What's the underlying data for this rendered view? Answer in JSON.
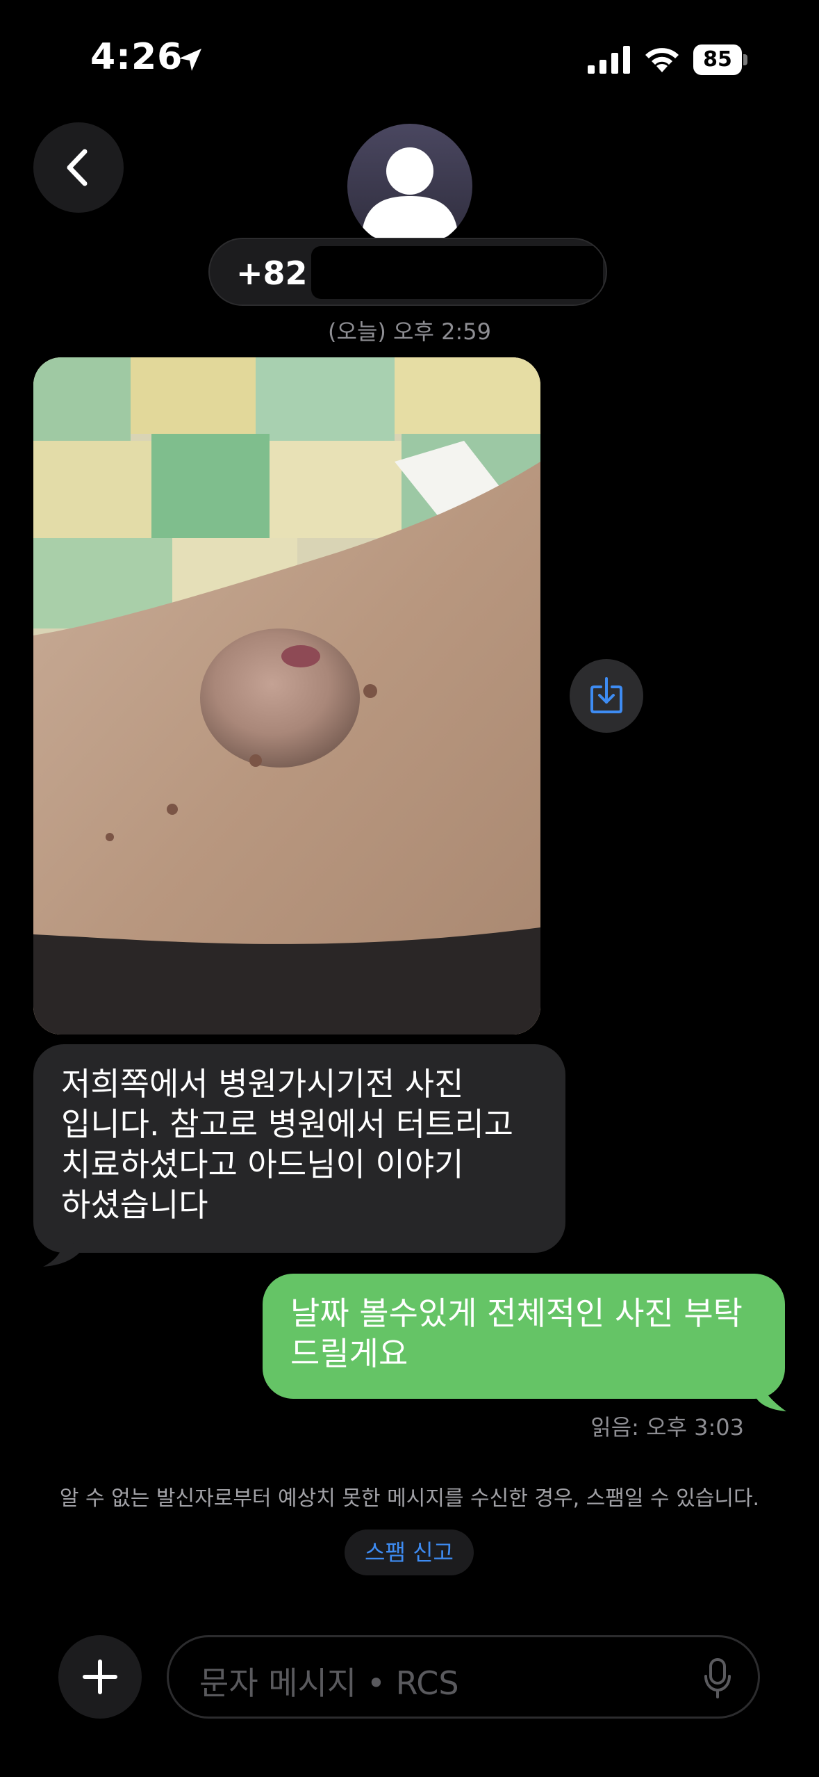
{
  "status_bar": {
    "time": "4:26",
    "battery": "85",
    "icons": [
      "location-arrow-icon",
      "cellular-signal-icon",
      "wifi-icon",
      "battery-icon"
    ]
  },
  "header": {
    "contact_number": "+82 1",
    "subtitle_hidden": "",
    "timestamp": "(오늘) 오후 2:59"
  },
  "messages": {
    "incoming_text_lines": [
      "저희쪽에서 병원가시기전 사진",
      "입니다. 참고로 병원에서 터트리고",
      "치료하셨다고 아드님이 이야기",
      "하셨습니다"
    ],
    "outgoing_text_lines": [
      "날짜 볼수있게 전체적인 사진 부탁",
      "드릴게요"
    ],
    "read_receipt": "읽음: 오후 3:03"
  },
  "spam": {
    "notice": "알 수 없는 발신자로부터 예상치 못한 메시지를 수신한 경우, 스팸일 수 있습니다.",
    "report_label": "스팸 신고"
  },
  "composer": {
    "placeholder": "문자 메시지 • RCS"
  },
  "colors": {
    "background": "#000000",
    "incoming_bubble": "#262628",
    "outgoing_bubble": "#65c466",
    "accent_blue": "#3e8cf3",
    "secondary_text": "#8e8e93"
  }
}
